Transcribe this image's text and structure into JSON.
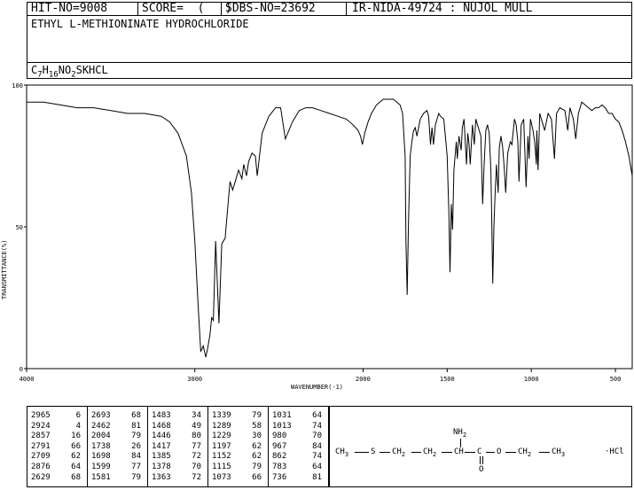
{
  "header": {
    "hit_no": "HIT-NO=9008",
    "score": "SCORE=  (   )",
    "sdbs_no": "SDBS-NO=23692",
    "ir_code": "IR-NIDA-49724 : NUJOL MULL"
  },
  "compound": {
    "name": "ETHYL L-METHIONINATE HYDROCHLORIDE",
    "formula_parts": [
      "C",
      "7",
      "H",
      "16",
      "NO",
      "2",
      "SKHCL"
    ]
  },
  "chart_data": {
    "type": "line",
    "xlabel": "WAVENUMBER(-1)",
    "ylabel": "TRANSMITTANCE(%)",
    "xlim": [
      4000,
      400
    ],
    "ylim": [
      0,
      100
    ],
    "x_ticks": [
      4000,
      3000,
      2000,
      1500,
      1000,
      500
    ],
    "y_ticks": [
      0,
      50,
      100
    ],
    "series": [
      {
        "x": [
          4000,
          3900,
          3800,
          3700,
          3600,
          3500,
          3400,
          3300,
          3200,
          3150,
          3100,
          3050,
          3020,
          3000,
          2980,
          2965,
          2950,
          2935,
          2924,
          2910,
          2900,
          2890,
          2876,
          2857,
          2840,
          2820,
          2800,
          2791,
          2775,
          2760,
          2740,
          2720,
          2709,
          2693,
          2680,
          2660,
          2640,
          2629,
          2600,
          2560,
          2520,
          2490,
          2462,
          2420,
          2380,
          2340,
          2300,
          2250,
          2200,
          2150,
          2100,
          2060,
          2030,
          2015,
          2004,
          1990,
          1970,
          1950,
          1920,
          1900,
          1880,
          1850,
          1820,
          1800,
          1780,
          1765,
          1750,
          1745,
          1738,
          1730,
          1720,
          1710,
          1700,
          1698,
          1690,
          1680,
          1670,
          1660,
          1640,
          1620,
          1610,
          1599,
          1590,
          1581,
          1570,
          1560,
          1550,
          1540,
          1520,
          1500,
          1490,
          1483,
          1475,
          1468,
          1460,
          1446,
          1440,
          1430,
          1417,
          1410,
          1400,
          1385,
          1378,
          1370,
          1363,
          1350,
          1339,
          1330,
          1320,
          1300,
          1289,
          1280,
          1270,
          1260,
          1250,
          1240,
          1235,
          1229,
          1222,
          1215,
          1207,
          1197,
          1190,
          1180,
          1170,
          1160,
          1152,
          1140,
          1125,
          1115,
          1100,
          1090,
          1080,
          1073,
          1060,
          1045,
          1031,
          1020,
          1013,
          1005,
          990,
          980,
          970,
          967,
          960,
          950,
          940,
          920,
          900,
          880,
          862,
          850,
          830,
          800,
          783,
          770,
          750,
          736,
          720,
          700,
          680,
          660,
          640,
          620,
          600,
          580,
          560,
          540,
          520,
          500,
          480,
          460,
          440,
          420,
          400
        ],
        "y": [
          94,
          94,
          93,
          92,
          92,
          91,
          90,
          90,
          89,
          87,
          83,
          75,
          62,
          45,
          22,
          6,
          8,
          4,
          7,
          12,
          18,
          17,
          45,
          16,
          44,
          46,
          60,
          66,
          63,
          66,
          70,
          67,
          72,
          68,
          73,
          76,
          75,
          68,
          83,
          89,
          92,
          92,
          81,
          87,
          91,
          92,
          92,
          91,
          90,
          89,
          88,
          86,
          84,
          82,
          79,
          83,
          87,
          90,
          93,
          94,
          95,
          95,
          95,
          94,
          93,
          90,
          75,
          45,
          26,
          52,
          75,
          80,
          84,
          84,
          85,
          82,
          85,
          88,
          90,
          91,
          89,
          79,
          85,
          79,
          86,
          88,
          90,
          89,
          88,
          75,
          55,
          34,
          58,
          49,
          70,
          80,
          74,
          82,
          77,
          85,
          88,
          72,
          83,
          79,
          72,
          86,
          79,
          88,
          86,
          82,
          58,
          72,
          84,
          86,
          83,
          70,
          52,
          30,
          50,
          62,
          72,
          62,
          78,
          82,
          78,
          70,
          62,
          76,
          80,
          79,
          88,
          86,
          80,
          66,
          86,
          88,
          64,
          82,
          74,
          88,
          84,
          80,
          72,
          84,
          70,
          90,
          88,
          84,
          90,
          88,
          74,
          90,
          92,
          91,
          84,
          92,
          88,
          81,
          90,
          94,
          93,
          92,
          91,
          92,
          92,
          93,
          92,
          90,
          90,
          88,
          87,
          84,
          80,
          75,
          68
        ]
      }
    ]
  },
  "peaks": [
    [
      [
        "2965",
        "6"
      ],
      [
        "2924",
        "4"
      ],
      [
        "2857",
        "16"
      ],
      [
        "2791",
        "66"
      ],
      [
        "2709",
        "62"
      ],
      [
        "2876",
        "64"
      ],
      [
        "2629",
        "68"
      ]
    ],
    [
      [
        "2693",
        "68"
      ],
      [
        "2462",
        "81"
      ],
      [
        "2004",
        "79"
      ],
      [
        "1738",
        "26"
      ],
      [
        "1698",
        "84"
      ],
      [
        "1599",
        "77"
      ],
      [
        "1581",
        "79"
      ]
    ],
    [
      [
        "1483",
        "34"
      ],
      [
        "1468",
        "49"
      ],
      [
        "1446",
        "80"
      ],
      [
        "1417",
        "77"
      ],
      [
        "1385",
        "72"
      ],
      [
        "1378",
        "70"
      ],
      [
        "1363",
        "72"
      ]
    ],
    [
      [
        "1339",
        "79"
      ],
      [
        "1289",
        "58"
      ],
      [
        "1229",
        "30"
      ],
      [
        "1197",
        "62"
      ],
      [
        "1152",
        "62"
      ],
      [
        "1115",
        "79"
      ],
      [
        "1073",
        "66"
      ]
    ],
    [
      [
        "1031",
        "64"
      ],
      [
        "1013",
        "74"
      ],
      [
        "980",
        "70"
      ],
      [
        "967",
        "84"
      ],
      [
        "862",
        "74"
      ],
      [
        "783",
        "64"
      ],
      [
        "736",
        "81"
      ]
    ]
  ],
  "structure": {
    "nh2": "NH",
    "nh2_sub": "2",
    "o": "O",
    "chain": [
      {
        "t": "CH",
        "s": "3"
      },
      {
        "t": "S"
      },
      {
        "t": "CH",
        "s": "2"
      },
      {
        "t": "CH",
        "s": "2"
      },
      {
        "t": "CH"
      },
      {
        "t": "C"
      },
      {
        "t": "O"
      },
      {
        "t": "CH",
        "s": "2"
      },
      {
        "t": "CH",
        "s": "3"
      }
    ],
    "salt": "·HCl"
  }
}
